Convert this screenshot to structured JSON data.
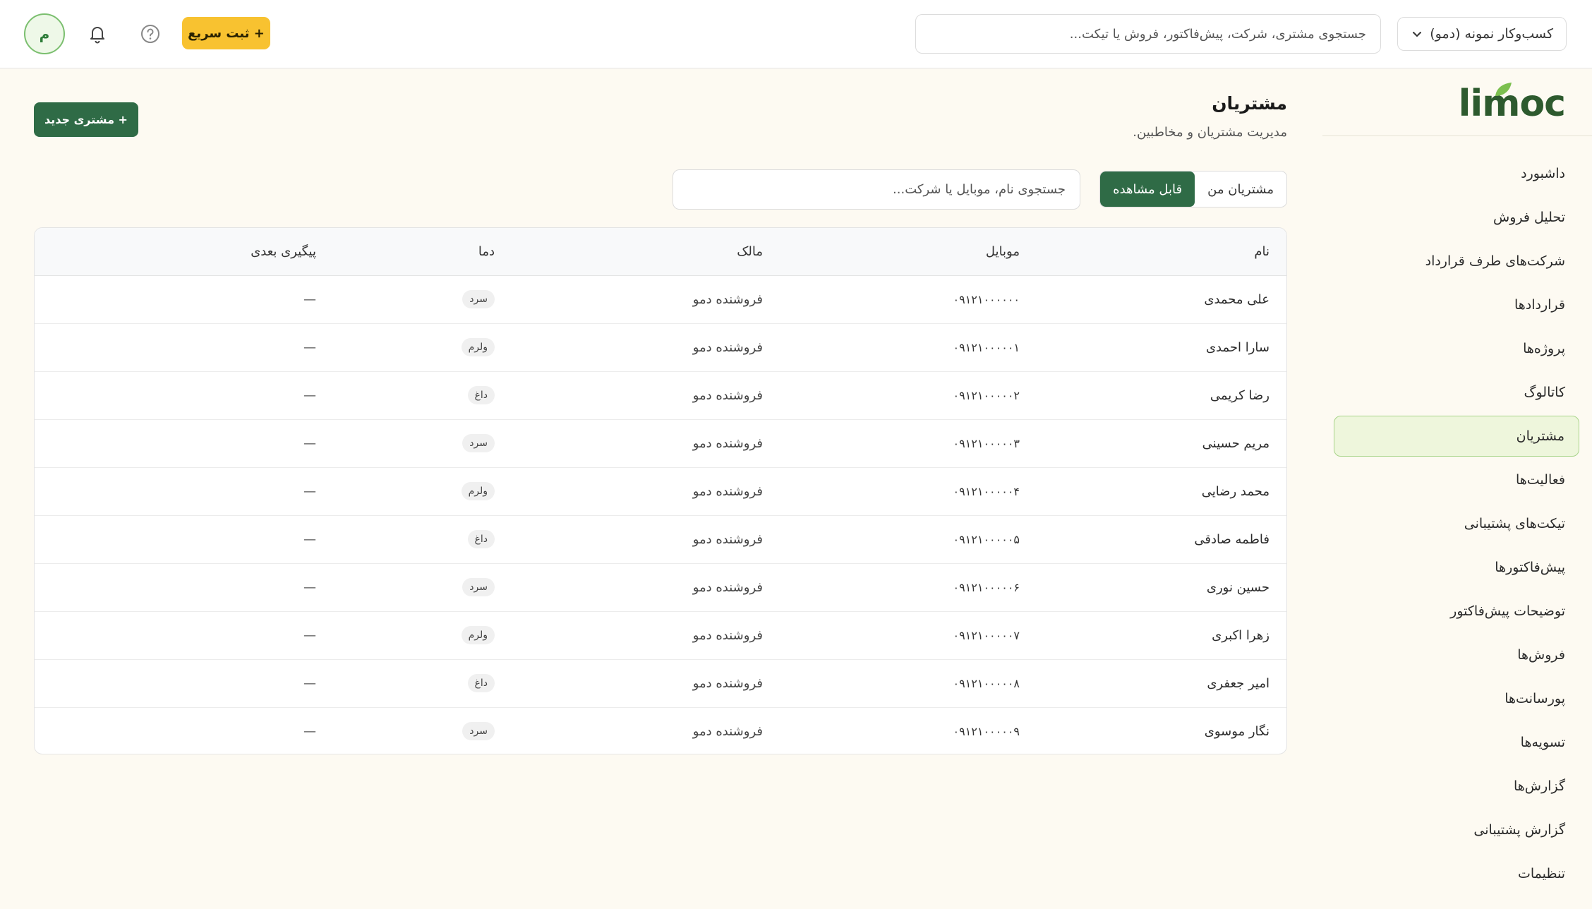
{
  "topbar": {
    "business_select": "کسب‌وکار نمونه (دمو)",
    "search_placeholder": "جستجوی مشتری، شرکت، پیش‌فاکتور، فروش یا تیکت...",
    "quick_add_label": "+ ثبت سریع",
    "avatar_initial": "م"
  },
  "sidebar": {
    "logo": "limoc",
    "items": [
      {
        "label": "داشبورد"
      },
      {
        "label": "تحلیل فروش"
      },
      {
        "label": "شرکت‌های طرف قرارداد"
      },
      {
        "label": "قراردادها"
      },
      {
        "label": "پروژه‌ها"
      },
      {
        "label": "کاتالوگ"
      },
      {
        "label": "مشتریان",
        "active": true
      },
      {
        "label": "فعالیت‌ها"
      },
      {
        "label": "تیکت‌های پشتیبانی"
      },
      {
        "label": "پیش‌فاکتورها"
      },
      {
        "label": "توضیحات پیش‌فاکتور"
      },
      {
        "label": "فروش‌ها"
      },
      {
        "label": "پورسانت‌ها"
      },
      {
        "label": "تسویه‌ها"
      },
      {
        "label": "گزارش‌ها"
      },
      {
        "label": "گزارش پشتیبانی"
      },
      {
        "label": "تنظیمات"
      }
    ]
  },
  "main": {
    "title": "مشتریان",
    "subtitle": "مدیریت مشتریان و مخاطبین.",
    "new_customer_label": "+ مشتری جدید",
    "segments": [
      "مشتریان من",
      "قابل مشاهده"
    ],
    "active_segment": "قابل مشاهده",
    "search_placeholder": "جستجوی نام، موبایل یا شرکت...",
    "table": {
      "headers": [
        "نام",
        "موبایل",
        "مالک",
        "دما",
        "پیگیری بعدی"
      ],
      "rows": [
        {
          "name": "علی محمدی",
          "mobile": "۰۹۱۲۱۰۰۰۰۰۰",
          "owner": "فروشنده دمو",
          "temp": "سرد",
          "next": "—"
        },
        {
          "name": "سارا احمدی",
          "mobile": "۰۹۱۲۱۰۰۰۰۰۱",
          "owner": "فروشنده دمو",
          "temp": "ولرم",
          "next": "—"
        },
        {
          "name": "رضا کریمی",
          "mobile": "۰۹۱۲۱۰۰۰۰۰۲",
          "owner": "فروشنده دمو",
          "temp": "داغ",
          "next": "—"
        },
        {
          "name": "مریم حسینی",
          "mobile": "۰۹۱۲۱۰۰۰۰۰۳",
          "owner": "فروشنده دمو",
          "temp": "سرد",
          "next": "—"
        },
        {
          "name": "محمد رضایی",
          "mobile": "۰۹۱۲۱۰۰۰۰۰۴",
          "owner": "فروشنده دمو",
          "temp": "ولرم",
          "next": "—"
        },
        {
          "name": "فاطمه صادقی",
          "mobile": "۰۹۱۲۱۰۰۰۰۰۵",
          "owner": "فروشنده دمو",
          "temp": "داغ",
          "next": "—"
        },
        {
          "name": "حسین نوری",
          "mobile": "۰۹۱۲۱۰۰۰۰۰۶",
          "owner": "فروشنده دمو",
          "temp": "سرد",
          "next": "—"
        },
        {
          "name": "زهرا اکبری",
          "mobile": "۰۹۱۲۱۰۰۰۰۰۷",
          "owner": "فروشنده دمو",
          "temp": "ولرم",
          "next": "—"
        },
        {
          "name": "امیر جعفری",
          "mobile": "۰۹۱۲۱۰۰۰۰۰۸",
          "owner": "فروشنده دمو",
          "temp": "داغ",
          "next": "—"
        },
        {
          "name": "نگار موسوی",
          "mobile": "۰۹۱۲۱۰۰۰۰۰۹",
          "owner": "فروشنده دمو",
          "temp": "سرد",
          "next": "—"
        }
      ]
    }
  },
  "colors": {
    "primary_green": "#2f6b46",
    "accent_yellow": "#f8c230",
    "active_nav_bg": "#eef6dc",
    "page_bg": "#fdfaf2"
  }
}
